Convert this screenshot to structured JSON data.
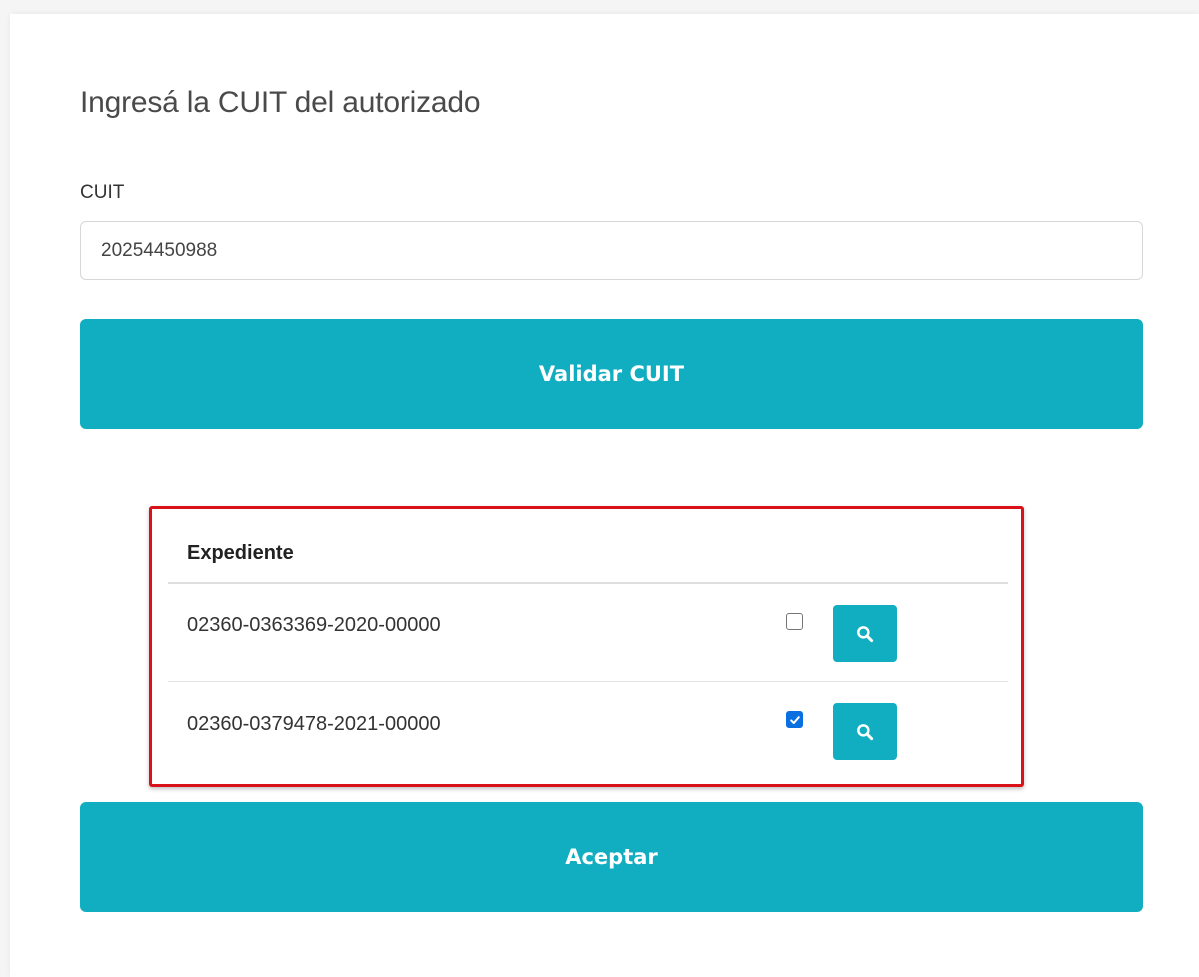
{
  "form": {
    "heading": "Ingresá la CUIT del autorizado",
    "cuit_label": "CUIT",
    "cuit_value": "20254450988",
    "validate_label": "Validar CUIT",
    "accept_label": "Aceptar"
  },
  "table": {
    "header": "Expediente",
    "rows": [
      {
        "expediente": "02360-0363369-2020-00000",
        "checked": false
      },
      {
        "expediente": "02360-0379478-2021-00000",
        "checked": true
      }
    ]
  },
  "colors": {
    "accent": "#11aec1",
    "highlight_border": "#d9121a",
    "checkbox_checked": "#0a6fe0"
  },
  "icons": {
    "row_action": "search-icon",
    "checked": "checkmark-icon"
  }
}
